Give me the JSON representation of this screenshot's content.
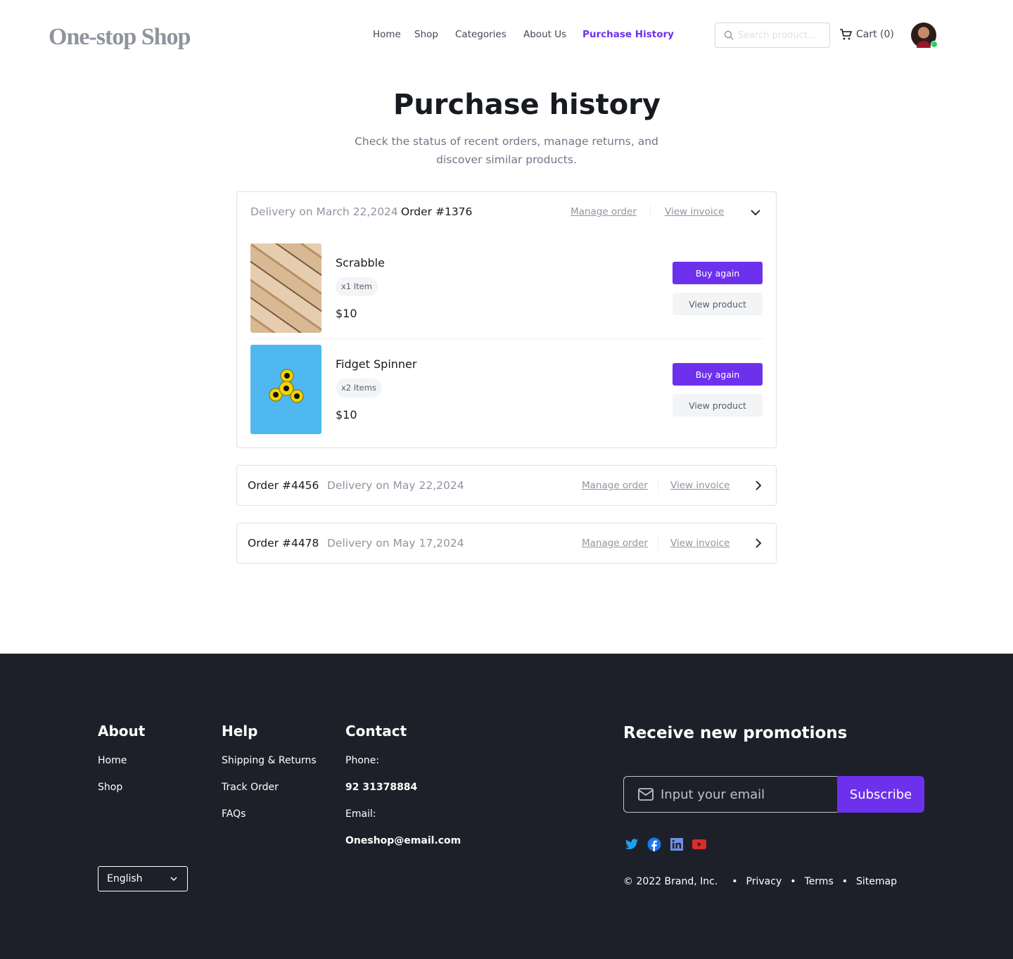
{
  "brand": "One-stop Shop",
  "nav": [
    {
      "label": "Home"
    },
    {
      "label": "Shop"
    },
    {
      "label": "Categories"
    },
    {
      "label": "About Us"
    },
    {
      "label": "Purchase History",
      "active": true
    }
  ],
  "search": {
    "placeholder": "Search product..."
  },
  "cart": {
    "label": "Cart (0)"
  },
  "page": {
    "title": "Purchase history",
    "subtitle": "Check the status of recent orders, manage returns, and discover similar products."
  },
  "orders": [
    {
      "order": "Order #1376",
      "delivery": "Delivery on March 22,2024",
      "manage": "Manage order",
      "invoice": "View invoice",
      "expanded": true,
      "items": [
        {
          "name": "Scrabble",
          "qty": "x1 Item",
          "price": "$10",
          "buy": "Buy again",
          "view": "View product"
        },
        {
          "name": "Fidget Spinner",
          "qty": "x2 Items",
          "price": "$10",
          "buy": "Buy again",
          "view": "View product"
        }
      ]
    },
    {
      "order": "Order #4456",
      "delivery": "Delivery on May 22,2024",
      "manage": "Manage order",
      "invoice": "View invoice",
      "expanded": false
    },
    {
      "order": "Order #4478",
      "delivery": "Delivery on May 17,2024",
      "manage": "Manage order",
      "invoice": "View invoice",
      "expanded": false
    }
  ],
  "footer": {
    "about": {
      "title": "About",
      "links": [
        "Home",
        "Shop"
      ]
    },
    "help": {
      "title": "Help",
      "links": [
        "Shipping & Returns",
        "Track Order",
        "FAQs"
      ]
    },
    "contact": {
      "title": "Contact",
      "phone_label": "Phone:",
      "phone": "92 31378884",
      "email_label": "Email:",
      "email": "Oneshop@email.com"
    },
    "language": "English",
    "promo": {
      "title": "Receive new promotions",
      "placeholder": "Input your email",
      "button": "Subscribe"
    },
    "social": [
      "twitter-icon",
      "facebook-icon",
      "linkedin-icon",
      "youtube-icon"
    ],
    "copyright": "© 2022 Brand, Inc.",
    "links": [
      "Privacy",
      "Terms",
      "Sitemap"
    ]
  },
  "colors": {
    "accent": "#6d31ed",
    "footer_bg": "#1e2029"
  }
}
